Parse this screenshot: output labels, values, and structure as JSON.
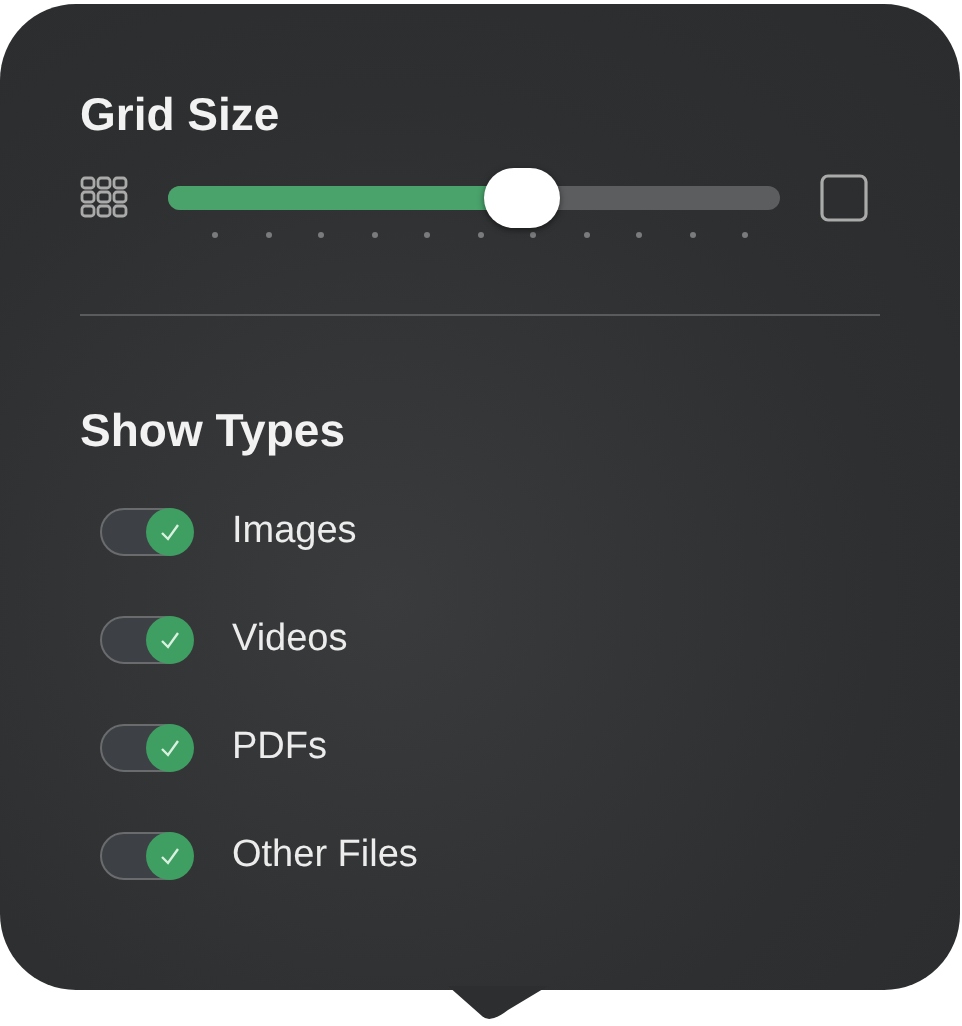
{
  "grid_size": {
    "title": "Grid Size",
    "level": 0.58
  },
  "show_types": {
    "title": "Show Types",
    "items": [
      {
        "label": "Images",
        "on": true
      },
      {
        "label": "Videos",
        "on": true
      },
      {
        "label": "PDFs",
        "on": true
      },
      {
        "label": "Other Files",
        "on": true
      }
    ]
  }
}
